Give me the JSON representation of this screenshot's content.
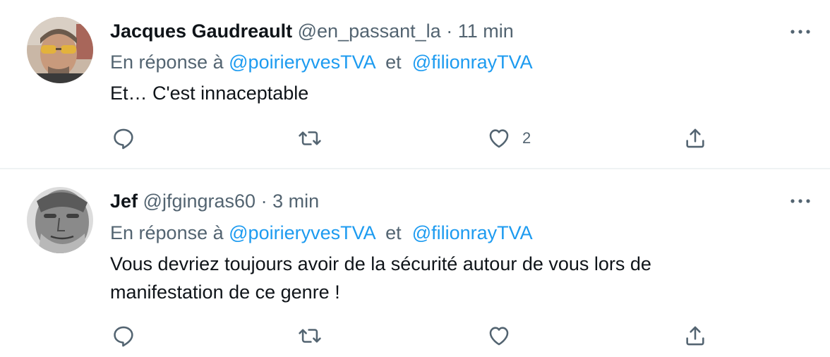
{
  "colors": {
    "link": "#1d9bf0",
    "secondary_text": "#536471",
    "primary_text": "#0f1419",
    "divider": "#eff3f4"
  },
  "tweets": [
    {
      "author_name": "Jacques Gaudreault",
      "handle": "@en_passant_la",
      "separator": "·",
      "time": "11 min",
      "reply_prefix": "En réponse à",
      "mention_1": "@poirieryvesTVA",
      "reply_conjunction": "et",
      "mention_2": "@filionrayTVA",
      "text_lines": [
        "Et… C'est innaceptable"
      ],
      "like_count": "2",
      "icons": [
        "reply-icon",
        "retweet-icon",
        "heart-icon",
        "share-icon",
        "more-icon"
      ]
    },
    {
      "author_name": "Jef",
      "handle": "@jfgingras60",
      "separator": "·",
      "time": "3 min",
      "reply_prefix": "En réponse à",
      "mention_1": "@poirieryvesTVA",
      "reply_conjunction": "et",
      "mention_2": "@filionrayTVA",
      "text_lines": [
        "Vous devriez toujours avoir de la sécurité autour de vous lors de",
        "manifestation de ce genre !"
      ],
      "like_count": "",
      "icons": [
        "reply-icon",
        "retweet-icon",
        "heart-icon",
        "share-icon",
        "more-icon"
      ]
    }
  ]
}
